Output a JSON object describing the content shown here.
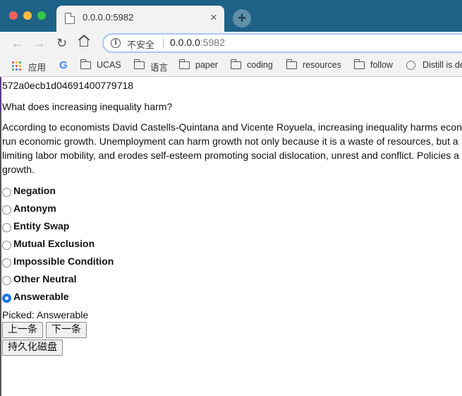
{
  "browser": {
    "tab_title": "0.0.0.0:5982",
    "close_glyph": "×",
    "new_tab_glyph": "+",
    "security_label": "不安全",
    "url_host": "0.0.0.0",
    "url_port": ":5982",
    "icons": [
      "back-arrow-icon",
      "forward-arrow-icon",
      "reload-icon",
      "home-icon",
      "info-icon"
    ]
  },
  "bookmarks": [
    {
      "label": "应用",
      "icon": "apps-grid-icon"
    },
    {
      "label": "",
      "icon": "google-icon"
    },
    {
      "label": "UCAS",
      "icon": "folder-icon"
    },
    {
      "label": "语言",
      "icon": "folder-icon"
    },
    {
      "label": "paper",
      "icon": "folder-icon"
    },
    {
      "label": "coding",
      "icon": "folder-icon"
    },
    {
      "label": "resources",
      "icon": "folder-icon"
    },
    {
      "label": "follow",
      "icon": "folder-icon"
    },
    {
      "label": "Distill is de",
      "icon": "distill-icon"
    }
  ],
  "page": {
    "record_id": "572a0ecb1d04691400779718",
    "question": "What does increasing inequality harm?",
    "passage_lines": [
      "According to economists David Castells-Quintana and Vicente Royuela, increasing inequality harms econ",
      "run economic growth. Unemployment can harm growth not only because it is a waste of resources, but a",
      "limiting labor mobility, and erodes self-esteem promoting social dislocation, unrest and conflict. Policies a",
      "growth."
    ],
    "options": [
      {
        "label": "Negation",
        "checked": false
      },
      {
        "label": "Antonym",
        "checked": false
      },
      {
        "label": "Entity Swap",
        "checked": false
      },
      {
        "label": "Mutual Exclusion",
        "checked": false
      },
      {
        "label": "Impossible Condition",
        "checked": false
      },
      {
        "label": "Other Neutral",
        "checked": false
      },
      {
        "label": "Answerable",
        "checked": true
      }
    ],
    "picked_text": "Picked: Answerable",
    "prev_button": "上一条",
    "next_button": "下一条",
    "persist_button": "持久化磁盘"
  },
  "colors": {
    "tabstrip": "#1e6287",
    "radio_checked": "#1a73e8"
  }
}
